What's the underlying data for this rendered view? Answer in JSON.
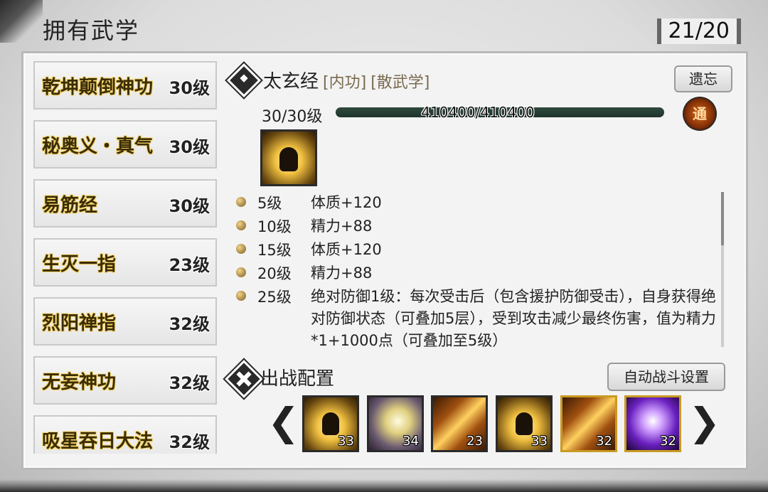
{
  "header": {
    "title": "拥有武学",
    "count": "21/20"
  },
  "skills": [
    {
      "name": "乾坤颠倒神功",
      "level": "30级"
    },
    {
      "name": "秘奥义・真气",
      "level": "30级"
    },
    {
      "name": "易筋经",
      "level": "30级"
    },
    {
      "name": "生灭一指",
      "level": "23级"
    },
    {
      "name": "烈阳禅指",
      "level": "32级"
    },
    {
      "name": "无妄神功",
      "level": "32级"
    },
    {
      "name": "吸星吞日大法",
      "level": "32级"
    }
  ],
  "detail": {
    "name": "太玄经",
    "tag1": "[内功]",
    "tag2": "[散武学]",
    "forget_label": "遗忘",
    "level_text": "30/30级",
    "exp_text": "410400/410400",
    "exp_progress": 1.0,
    "tong_label": "通",
    "effects": [
      {
        "level": "5级",
        "text": "体质+120"
      },
      {
        "level": "10级",
        "text": "精力+88"
      },
      {
        "level": "15级",
        "text": "体质+120"
      },
      {
        "level": "20级",
        "text": "精力+88"
      },
      {
        "level": "25级",
        "text": "绝对防御1级：每次受击后（包含援护防御受击），自身获得绝对防御状态（可叠加5层），受到攻击减少最终伤害，值为精力*1+1000点（可叠加至5级）"
      }
    ]
  },
  "battle": {
    "title": "出战配置",
    "auto_label": "自动战斗设置",
    "slots": [
      {
        "icon": "meditating-monk-icon",
        "level": "33"
      },
      {
        "icon": "glowing-palm-icon",
        "level": "34"
      },
      {
        "icon": "flaming-finger-icon",
        "level": "23"
      },
      {
        "icon": "meditating-monk-icon",
        "level": "33"
      },
      {
        "icon": "flaming-finger-icon",
        "level": "32"
      },
      {
        "icon": "purple-energy-fist-icon",
        "level": "32"
      }
    ],
    "prev_arrow": "❮",
    "next_arrow": "❯"
  }
}
